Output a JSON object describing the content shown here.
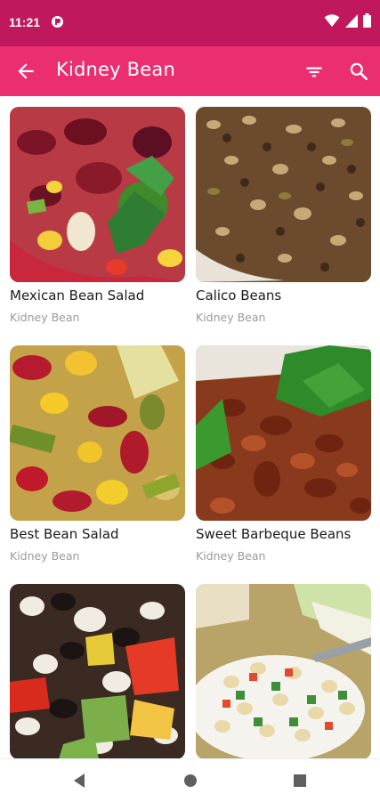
{
  "status_bar": {
    "time": "11:21",
    "app_icon": "ring-logo-icon",
    "icons": [
      "wifi-icon",
      "cellular-signal-icon",
      "battery-icon"
    ]
  },
  "app_bar": {
    "title": "Kidney Bean",
    "back_icon": "arrow-back-icon",
    "filter_icon": "filter-icon",
    "search_icon": "search-icon",
    "background": "#ea2e6f",
    "status_background": "#c0185d"
  },
  "recipes": [
    {
      "title": "Mexican Bean Salad",
      "category": "Kidney Bean"
    },
    {
      "title": "Calico Beans",
      "category": "Kidney Bean"
    },
    {
      "title": "Best Bean Salad",
      "category": "Kidney Bean"
    },
    {
      "title": "Sweet Barbeque Beans",
      "category": "Kidney Bean"
    },
    {
      "title": "",
      "category": ""
    },
    {
      "title": "",
      "category": ""
    }
  ],
  "nav_bar": {
    "icons": [
      "nav-back-icon",
      "nav-home-icon",
      "nav-recents-icon"
    ]
  }
}
